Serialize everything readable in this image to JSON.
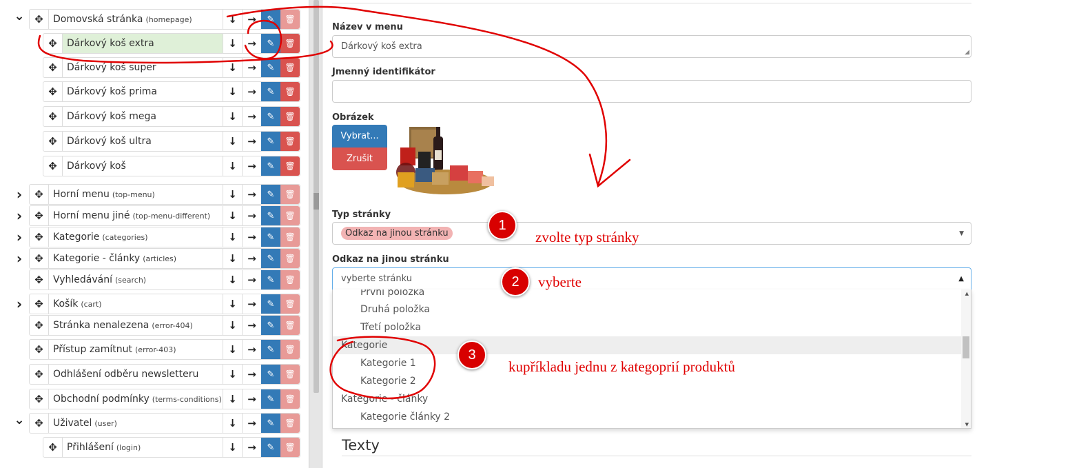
{
  "tree": {
    "rows": [
      {
        "caret": "chevron-down",
        "indent": 0,
        "label": "Domovská stránka",
        "slug": "(homepage)",
        "light_delete": true
      },
      {
        "caret": "",
        "indent": 1,
        "label": "Dárkový koš extra",
        "slug": "",
        "active": true,
        "light_delete": false
      },
      {
        "caret": "",
        "indent": 1,
        "label": "Dárkový koš super",
        "slug": "",
        "light_delete": false
      },
      {
        "caret": "",
        "indent": 1,
        "label": "Dárkový koš prima",
        "slug": "",
        "light_delete": false
      },
      {
        "caret": "",
        "indent": 1,
        "label": "Dárkový koš mega",
        "slug": "",
        "light_delete": false
      },
      {
        "caret": "",
        "indent": 1,
        "label": "Dárkový koš ultra",
        "slug": "",
        "light_delete": false
      },
      {
        "caret": "",
        "indent": 1,
        "label": "Dárkový koš",
        "slug": "",
        "light_delete": false
      },
      {
        "caret": "chevron-right",
        "indent": 0,
        "label": "Horní menu",
        "slug": "(top-menu)",
        "light_delete": true
      },
      {
        "caret": "chevron-right",
        "indent": 0,
        "label": "Horní menu jiné",
        "slug": "(top-menu-different)",
        "light_delete": true
      },
      {
        "caret": "chevron-right",
        "indent": 0,
        "label": "Kategorie",
        "slug": "(categories)",
        "light_delete": true
      },
      {
        "caret": "chevron-right",
        "indent": 0,
        "label": "Kategorie - články",
        "slug": "(articles)",
        "light_delete": true
      },
      {
        "caret": "",
        "indent": 0,
        "label": "Vyhledávání",
        "slug": "(search)",
        "light_delete": true
      },
      {
        "caret": "chevron-right",
        "indent": 0,
        "label": "Košík",
        "slug": "(cart)",
        "light_delete": true
      },
      {
        "caret": "",
        "indent": 0,
        "label": "Stránka nenalezena",
        "slug": "(error-404)",
        "light_delete": true
      },
      {
        "caret": "",
        "indent": 0,
        "label": "Přístup zamítnut",
        "slug": "(error-403)",
        "light_delete": true
      },
      {
        "caret": "",
        "indent": 0,
        "label": "Odhlášení odběru newsletteru",
        "slug": "",
        "light_delete": true
      },
      {
        "caret": "",
        "indent": 0,
        "label": "Obchodní podmínky",
        "slug": "(terms-conditions)",
        "light_delete": true
      },
      {
        "caret": "chevron-down",
        "indent": 0,
        "label": "Uživatel",
        "slug": "(user)",
        "light_delete": true
      },
      {
        "caret": "",
        "indent": 1,
        "label": "Přihlášení",
        "slug": "(login)",
        "light_delete": true
      }
    ]
  },
  "form": {
    "menu_name_label": "Název v menu",
    "menu_name_value": "Dárkový koš extra",
    "identifier_label": "Jmenný identifikátor",
    "identifier_value": "",
    "image_label": "Obrázek",
    "choose_button": "Vybrat...",
    "cancel_button": "Zrušit",
    "page_type_label": "Typ stránky",
    "page_type_value": "Odkaz na jinou stránku",
    "link_label": "Odkaz na jinou stránku",
    "link_placeholder": "vyberte stránku",
    "options": [
      {
        "kind": "child",
        "text": "První položka",
        "partial": true
      },
      {
        "kind": "child",
        "text": "Druhá položka"
      },
      {
        "kind": "child",
        "text": "Třetí položka"
      },
      {
        "kind": "group",
        "text": "Kategorie",
        "highlighted": true
      },
      {
        "kind": "child",
        "text": "Kategorie 1"
      },
      {
        "kind": "child",
        "text": "Kategorie 2"
      },
      {
        "kind": "group",
        "text": "Kategorie - články"
      },
      {
        "kind": "child",
        "text": "Kategorie články 2"
      }
    ],
    "section_title": "Texty"
  },
  "annotations": {
    "badge1": "1",
    "badge2": "2",
    "badge3": "3",
    "text1": "zvolte typ stránky",
    "text2": "vyberte",
    "text3": "kupříkladu jednu z kategoprií produktů",
    "color": "#e00000"
  },
  "colors": {
    "edit_blue": "#337ab7",
    "delete_red": "#d9534f",
    "delete_light": "#e89a97",
    "active_green": "#dff0d8"
  }
}
